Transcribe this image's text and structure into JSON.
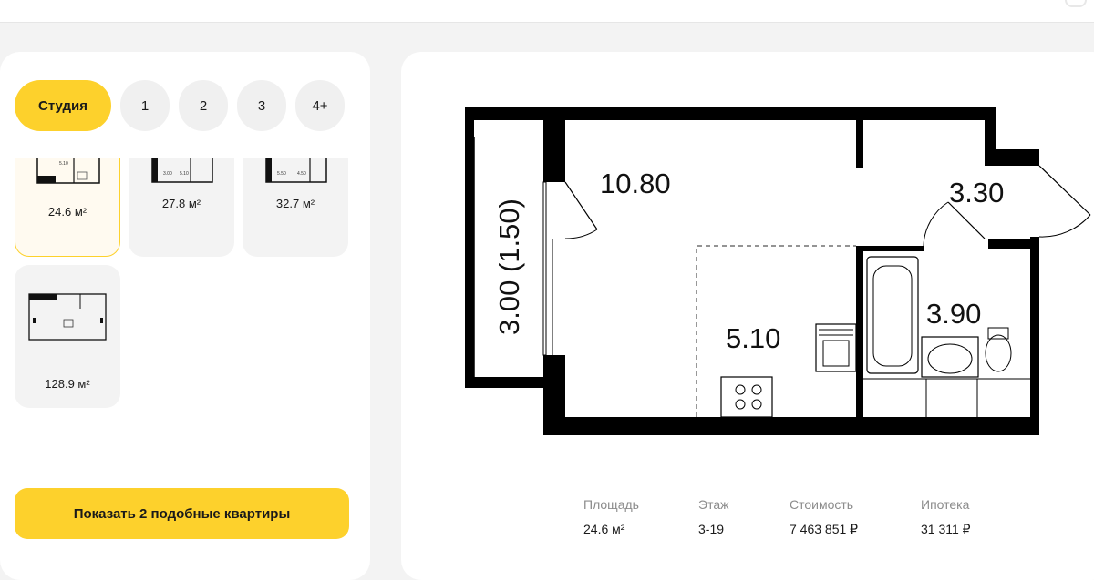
{
  "room_tabs": [
    "Студия",
    "1",
    "2",
    "3",
    "4+"
  ],
  "cards": [
    {
      "area": "24.6 м²",
      "selected": true
    },
    {
      "area": "27.8 м²"
    },
    {
      "area": "32.7 м²"
    },
    {
      "area": "128.9 м²"
    }
  ],
  "cta_label": "Показать 2 подобные квартиры",
  "plan": {
    "room_main": "10.80",
    "room_hall": "3.30",
    "room_kitchen": "5.10",
    "room_bath": "3.90",
    "balcony": "3.00 (1.50)"
  },
  "stats": [
    {
      "label": "Площадь",
      "value": "24.6 м²"
    },
    {
      "label": "Этаж",
      "value": "3-19"
    },
    {
      "label": "Стоимость",
      "value": "7 463 851 ₽"
    },
    {
      "label": "Ипотека",
      "value": "31 311 ₽"
    }
  ],
  "colors": {
    "accent": "#fdd12c",
    "wall": "#000000"
  }
}
